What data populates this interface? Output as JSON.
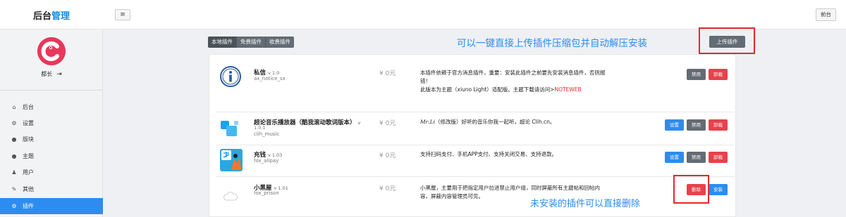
{
  "app": {
    "brand_a": "后台",
    "brand_b": "管理",
    "menu_toggle": "≡",
    "frontend_label": "前台"
  },
  "user": {
    "name": "都长",
    "logout": "⇥"
  },
  "nav": [
    {
      "label": "后台",
      "icon": "home-icon",
      "glyph": "⌂"
    },
    {
      "label": "设置",
      "icon": "gear-icon",
      "glyph": "⚙"
    },
    {
      "label": "版块",
      "icon": "comment-icon",
      "glyph": "●"
    },
    {
      "label": "主题",
      "icon": "comment-icon",
      "glyph": "●"
    },
    {
      "label": "用户",
      "icon": "user-icon",
      "glyph": "♟"
    },
    {
      "label": "其他",
      "icon": "wrench-icon",
      "glyph": "✎"
    },
    {
      "label": "插件",
      "icon": "cogs-icon",
      "glyph": "⚙"
    }
  ],
  "tabs": [
    "本地插件",
    "免费插件",
    "收费插件"
  ],
  "annotations": {
    "top": "可以一键直接上传插件压缩包并自动解压安装",
    "bottom": "未安装的插件可以直接删除"
  },
  "upload_label": "上传插件",
  "plugins": [
    {
      "name": "私信",
      "version": "v 1.0",
      "id": "ax_notice_sx",
      "price": "¥ 0元",
      "desc_lines": [
        "本插件依赖于官方消息插件，重要：安装此插件之前要先安装消息插件，否则报",
        "错！",
        "此版本为主题（xiuno Light）适配版。主题下载请访问>"
      ],
      "desc_link": "NOTEWEB",
      "buttons": [
        "禁用",
        "卸载"
      ]
    },
    {
      "name": "超论音乐播放器（酷我滚动歌词版本）",
      "version": "v",
      "version2": "1.0.1",
      "id": "clih_music",
      "price": "¥ 0元",
      "desc_brand": "𝑀𝑟.𝐿𝑖",
      "desc": "（修改版）好听的音乐你我一起听，超论 Clih.cn。",
      "buttons": [
        "设置",
        "禁用",
        "卸载"
      ]
    },
    {
      "name": "充钱",
      "version": "v 1.03",
      "id": "fox_alipay",
      "price": "¥ 0元",
      "desc": "支持扫码支付、手机APP支付、支持关闭交易、支持退款。",
      "buttons": [
        "设置",
        "禁用",
        "卸载"
      ]
    },
    {
      "name": "小黑屋",
      "version": "v 1.01",
      "id": "fox_prison",
      "price": "¥ 0元",
      "desc_lines": [
        "小黑屋，主要用于把指定用户拉进禁止用户组，同时屏蔽所有主题帖和回帖内",
        "容，屏蔽内容管理员可见。"
      ],
      "buttons": [
        "删除",
        "安装"
      ]
    }
  ],
  "colors": {
    "accent": "#2d8cf0",
    "danger": "#e8414b",
    "dark_button": "#636b74",
    "highlight_box": "#e8272a"
  }
}
